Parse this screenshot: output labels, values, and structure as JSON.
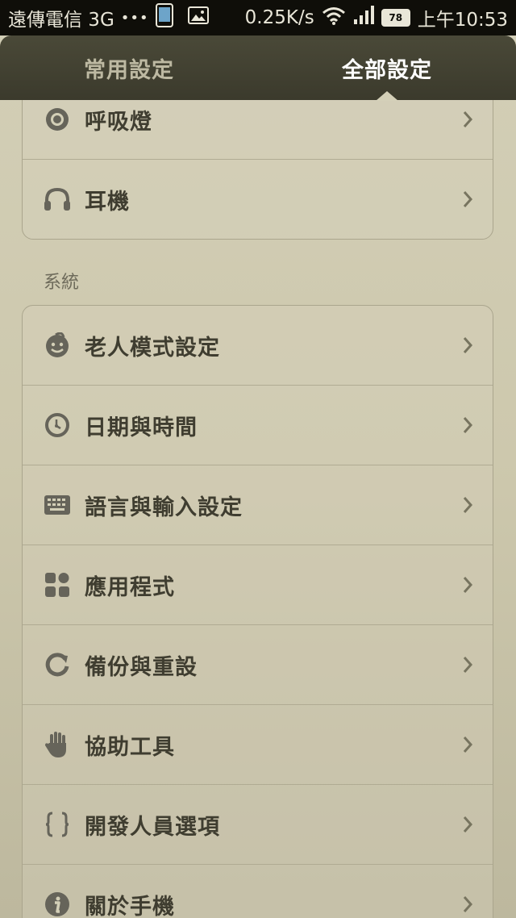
{
  "status_bar": {
    "carrier": "遠傳電信 3G",
    "dots": "•••",
    "speed": "0.25K/s",
    "battery": "78",
    "time": "上午10:53"
  },
  "tabs": [
    {
      "label": "常用設定",
      "active": false
    },
    {
      "label": "全部設定",
      "active": true
    }
  ],
  "top_group": {
    "items": [
      {
        "label": "呼吸燈",
        "icon": "breathing-light-icon"
      },
      {
        "label": "耳機",
        "icon": "headphones-icon"
      }
    ]
  },
  "system_section": {
    "title": "系統",
    "items": [
      {
        "label": "老人模式設定",
        "icon": "elder-mode-icon"
      },
      {
        "label": "日期與時間",
        "icon": "clock-icon"
      },
      {
        "label": "語言與輸入設定",
        "icon": "keyboard-icon"
      },
      {
        "label": "應用程式",
        "icon": "apps-icon"
      },
      {
        "label": "備份與重設",
        "icon": "backup-reset-icon"
      },
      {
        "label": "協助工具",
        "icon": "hand-icon"
      },
      {
        "label": "開發人員選項",
        "icon": "braces-icon"
      },
      {
        "label": "關於手機",
        "icon": "info-icon"
      }
    ]
  },
  "colors": {
    "background": "#d3cfb7",
    "header": "#3b3a2c",
    "text": "#3f3d30",
    "icon": "#66645a"
  }
}
